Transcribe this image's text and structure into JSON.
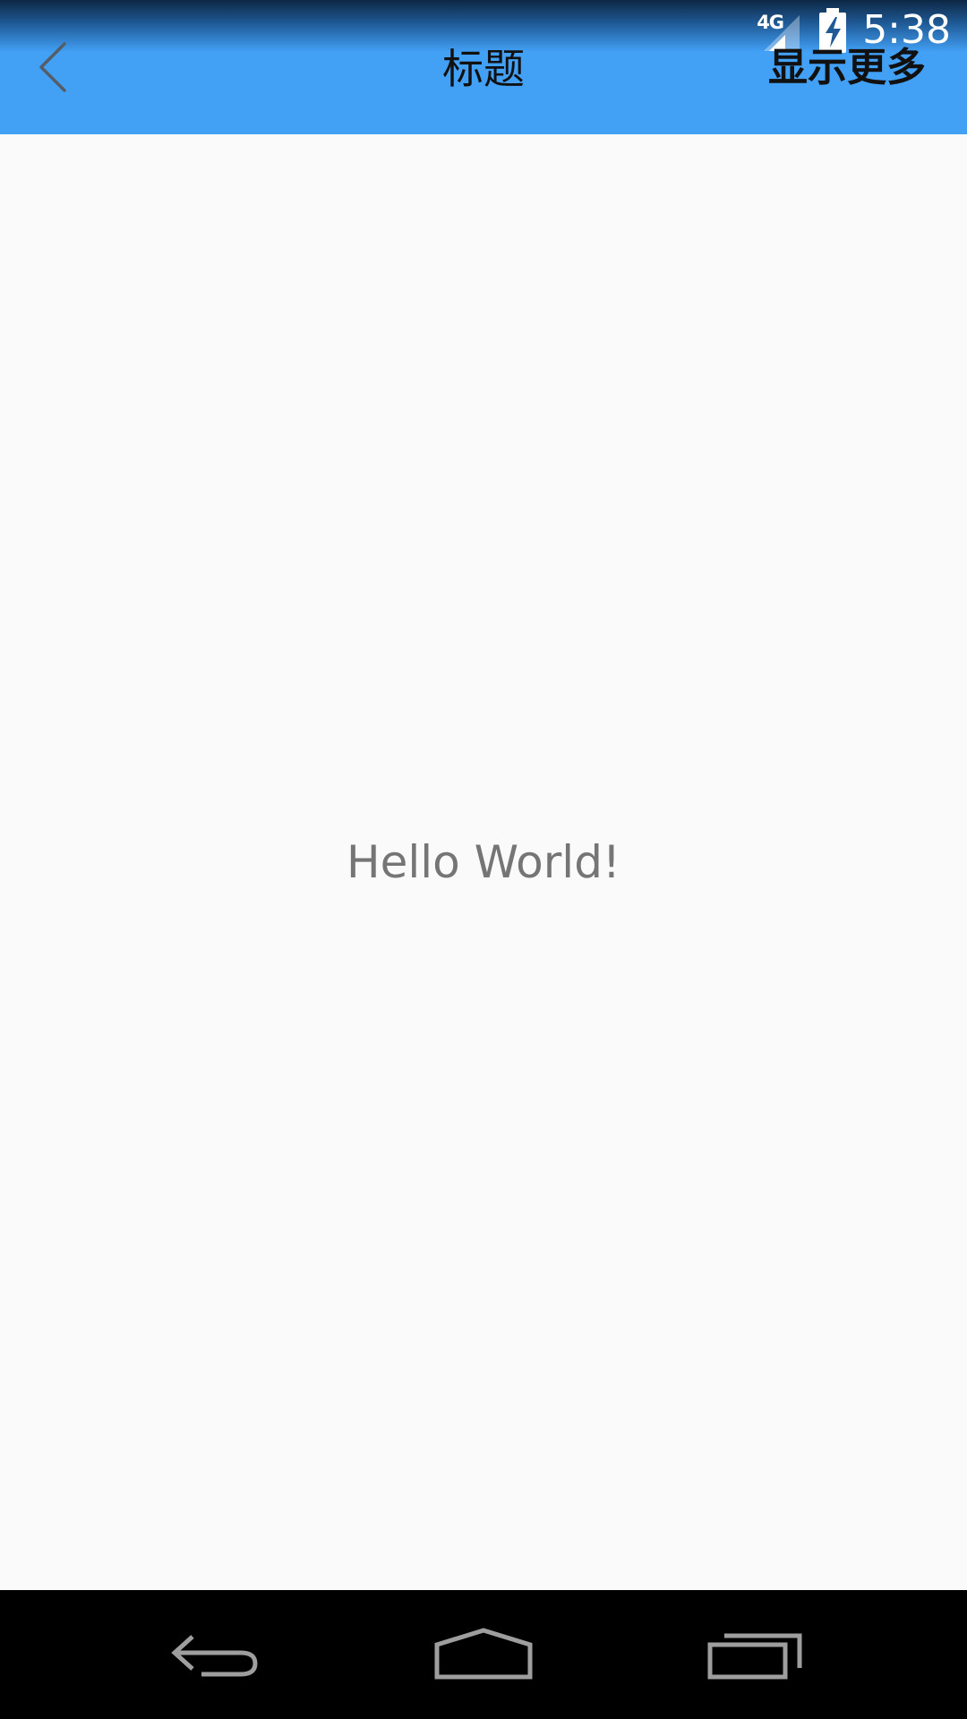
{
  "status_bar": {
    "network_type": "4G",
    "time": "5:38",
    "icons": [
      "signal-icon",
      "battery-charging-icon"
    ]
  },
  "app_bar": {
    "title": "标题",
    "back_icon": "chevron-left-icon",
    "action_label": "显示更多",
    "background_color": "#42a0f5"
  },
  "content": {
    "message": "Hello World!",
    "text_color": "#757575",
    "background_color": "#fafafa"
  },
  "nav_bar": {
    "buttons": [
      "back-nav-icon",
      "home-nav-icon",
      "recents-nav-icon"
    ],
    "background_color": "#000000"
  }
}
